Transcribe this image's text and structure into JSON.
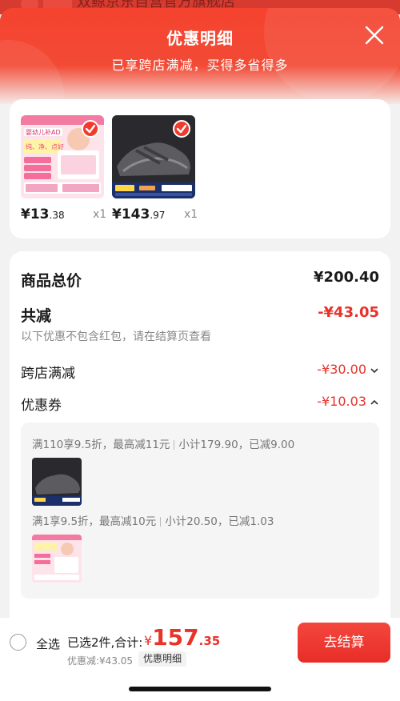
{
  "background": {
    "store_title": "双鲸京东自营官方旗舰店"
  },
  "header": {
    "title": "优惠明细",
    "subtitle": "已享跨店满减，买得多省得多"
  },
  "products": [
    {
      "price_int": "¥13",
      "price_dec": ".38",
      "qty": "x1",
      "name": "婴幼儿补AD",
      "tagline": "纯、净、点好",
      "selected": true
    },
    {
      "price_int": "¥143",
      "price_dec": ".97",
      "qty": "x1",
      "name": "运动鞋",
      "selected": true
    }
  ],
  "summary": {
    "total_label": "商品总价",
    "total_value": "¥200.40",
    "reduce_label": "共减",
    "reduce_value": "-¥43.05",
    "note": "以下优惠不包含红包，请在结算页查看",
    "cross_store_label": "跨店满减",
    "cross_store_value": "-¥30.00",
    "coupon_label": "优惠券",
    "coupon_value": "-¥10.03"
  },
  "coupons": [
    {
      "rule": "满110享9.5折，最高减11元",
      "detail": "小计179.90，已减9.00"
    },
    {
      "rule": "满1享9.5折，最高减10元",
      "detail": "小计20.50，已减1.03"
    }
  ],
  "bottom_bar": {
    "select_all": "全选",
    "selected_count": "已选2件,合计:",
    "currency": "¥",
    "total_int": "157",
    "total_dec": ".35",
    "discount_text": "优惠减:¥43.05",
    "detail_button": "优惠明细",
    "checkout_button": "去结算"
  },
  "colors": {
    "accent": "#e8322a",
    "header": "#f5432f",
    "background": "#f2f2f2"
  }
}
